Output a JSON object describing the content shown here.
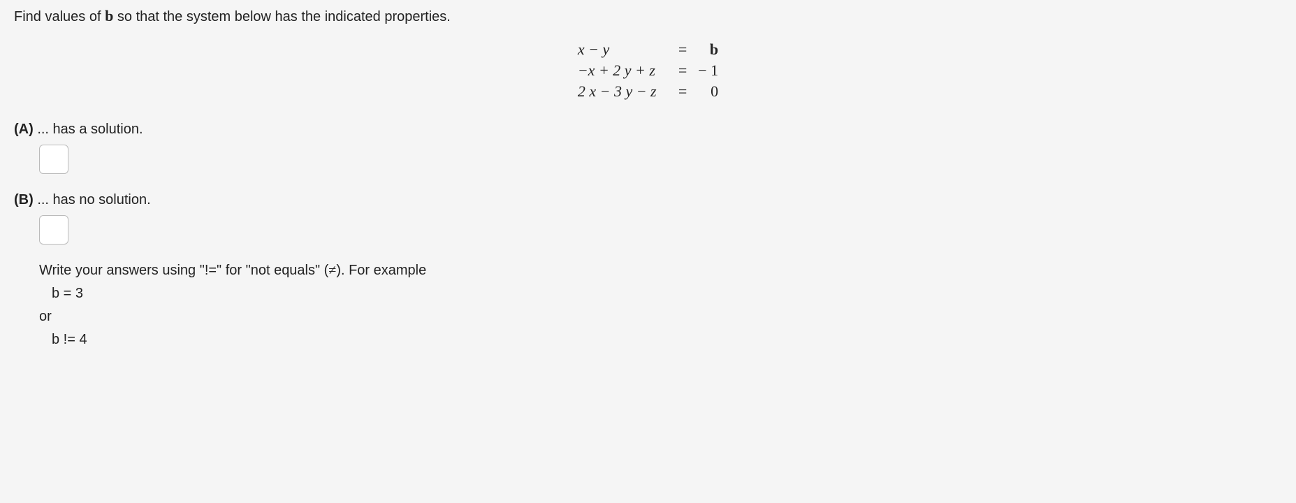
{
  "prompt_pre": "Find values of ",
  "prompt_var": "b",
  "prompt_post": " so that the system below has the indicated properties.",
  "equations": {
    "row1": {
      "lhs": "x −   y",
      "eq": "=",
      "rhs": "b"
    },
    "row2": {
      "lhs": "−x + 2 y + z",
      "eq": "=",
      "rhs": "− 1"
    },
    "row3": {
      "lhs": "2 x − 3 y − z",
      "eq": "=",
      "rhs": "0"
    }
  },
  "partA": {
    "label": "(A)",
    "text": " ... has a solution."
  },
  "partB": {
    "label": "(B)",
    "text": " ... has no solution."
  },
  "instructions": {
    "line1_pre": "Write your answers using \"!=\" for \"not equals\" (",
    "line1_sym": "≠",
    "line1_post": "). For example",
    "example1": "b = 3",
    "or": "or",
    "example2": "b != 4"
  }
}
